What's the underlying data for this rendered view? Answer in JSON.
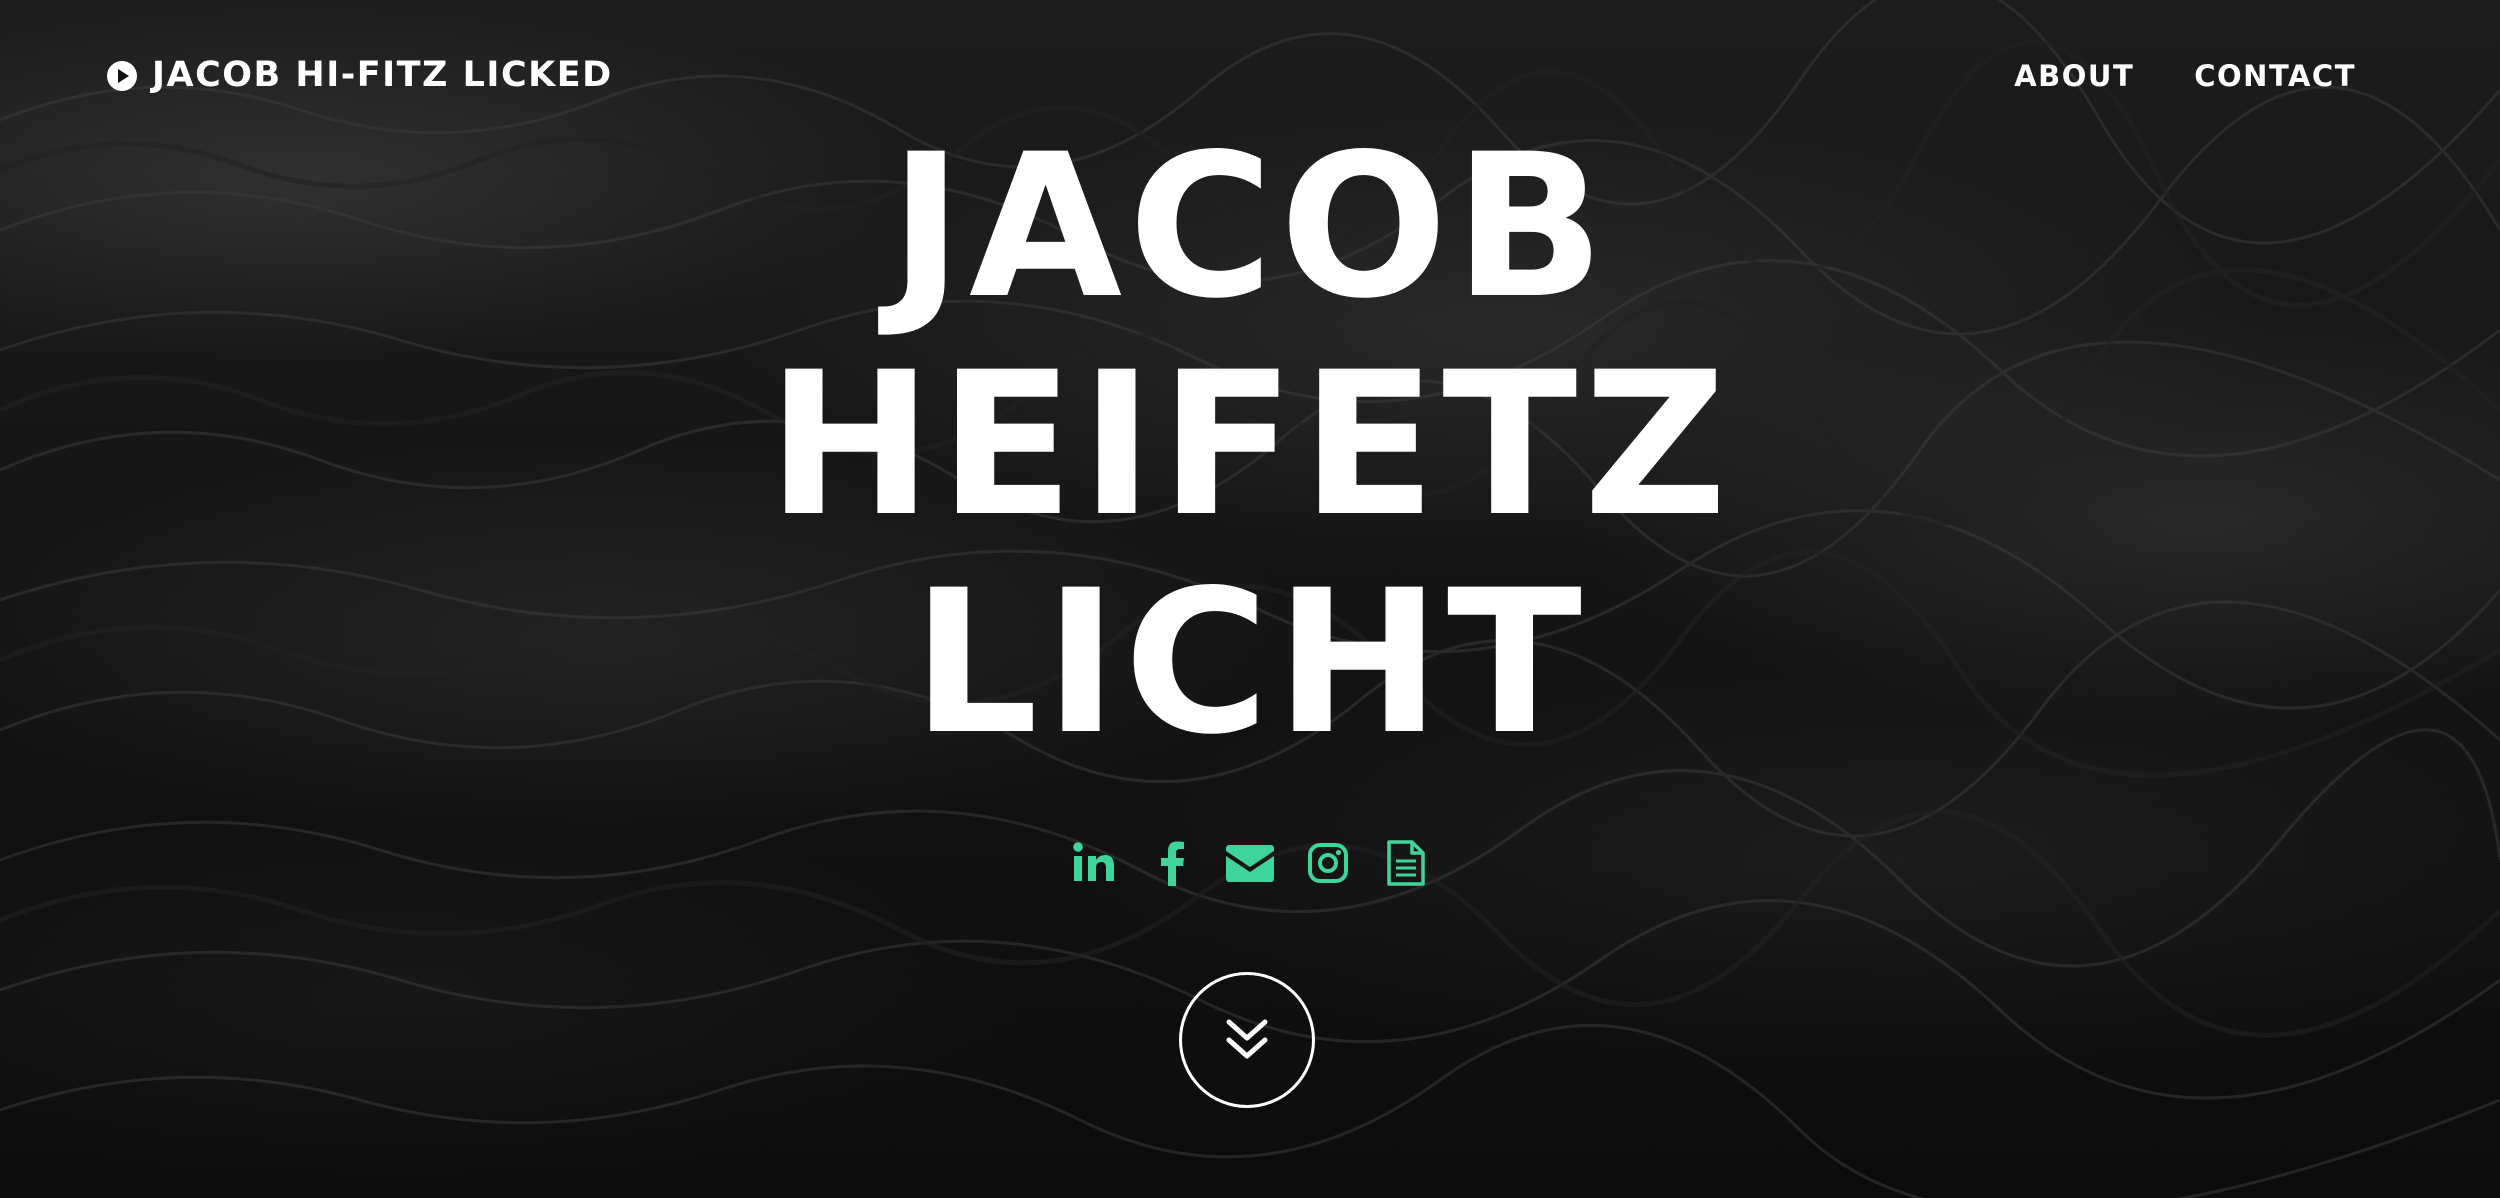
{
  "colors": {
    "accent": "#3ed49a",
    "text": "#ffffff",
    "background": "#141414"
  },
  "header": {
    "brand_icon": "play-circle-icon",
    "brand_label": "JACOB HI-FITZ LICKED",
    "nav": [
      {
        "label": "ABOUT"
      },
      {
        "label": "CONTACT"
      }
    ]
  },
  "hero": {
    "title_lines": [
      "JACOB",
      "HEIFETZ",
      "LICHT"
    ],
    "social_icons": [
      {
        "name": "linkedin-icon"
      },
      {
        "name": "facebook-icon"
      },
      {
        "name": "envelope-icon"
      },
      {
        "name": "instagram-icon"
      },
      {
        "name": "document-icon"
      }
    ],
    "scroll_icon": "double-chevron-down-icon"
  }
}
